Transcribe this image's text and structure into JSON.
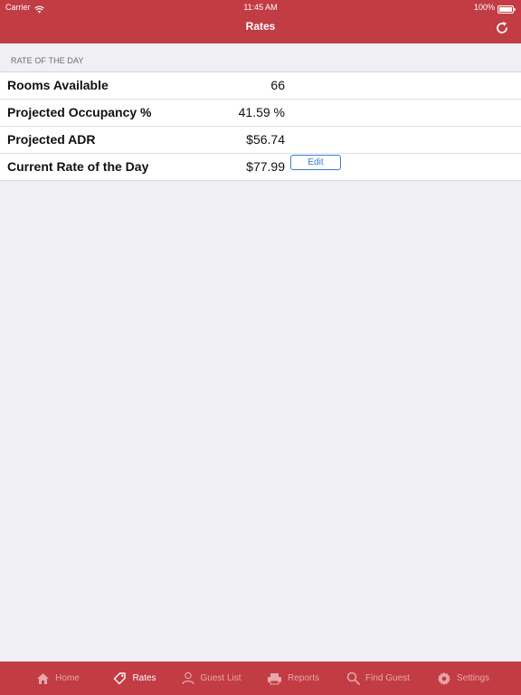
{
  "status_bar": {
    "carrier": "Carrier",
    "time": "11:45 AM",
    "battery": "100%"
  },
  "nav": {
    "title": "Rates",
    "refresh_icon": "refresh-icon"
  },
  "section": {
    "header": "RATE OF THE DAY"
  },
  "rows": [
    {
      "label": "Rooms Available",
      "value": "66"
    },
    {
      "label": "Projected Occupancy %",
      "value": "41.59 %"
    },
    {
      "label": "Projected ADR",
      "value": "$56.74"
    },
    {
      "label": "Current Rate of the Day",
      "value": "$77.99",
      "action": "Edit"
    }
  ],
  "tabs": [
    {
      "label": "Home",
      "icon": "home-icon",
      "active": false
    },
    {
      "label": "Rates",
      "icon": "tag-icon",
      "active": true
    },
    {
      "label": "Guest List",
      "icon": "person-icon",
      "active": false
    },
    {
      "label": "Reports",
      "icon": "printer-icon",
      "active": false
    },
    {
      "label": "Find Guest",
      "icon": "search-icon",
      "active": false
    },
    {
      "label": "Settings",
      "icon": "gear-icon",
      "active": false
    }
  ],
  "colors": {
    "accent": "#c23c44",
    "tab_inactive": "#e7a7ab",
    "link": "#2f7bd6",
    "background": "#efeff4"
  }
}
